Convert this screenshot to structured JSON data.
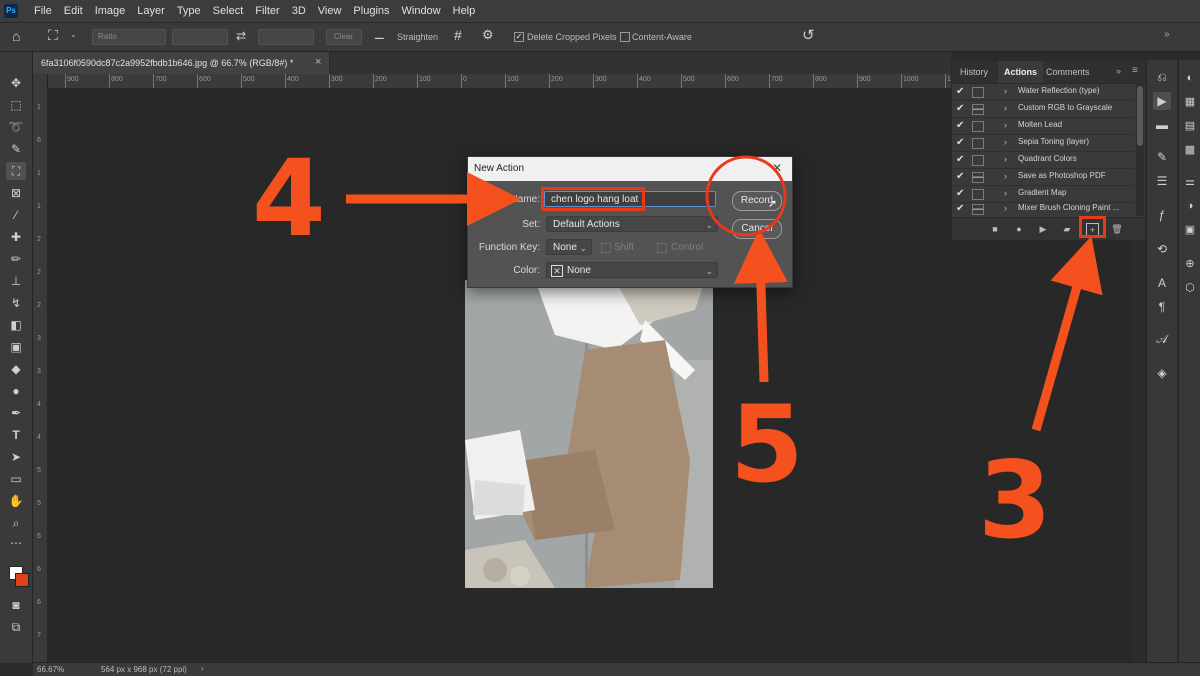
{
  "app": {
    "logo": "Ps"
  },
  "menu": [
    "File",
    "Edit",
    "Image",
    "Layer",
    "Type",
    "Select",
    "Filter",
    "3D",
    "View",
    "Plugins",
    "Window",
    "Help"
  ],
  "options_bar": {
    "ratio_label": "Ratio",
    "clear_label": "Clear",
    "straighten_label": "Straighten",
    "delete_cropped_label": "Delete Cropped Pixels",
    "delete_cropped_checked": true,
    "content_aware_label": "Content-Aware",
    "content_aware_checked": false
  },
  "document": {
    "tab_title": "6fa3106f0590dc87c2a9952fbdb1b646.jpg @ 66.7% (RGB/8#) *",
    "close_symbol": "×"
  },
  "ruler": {
    "h_ticks": [
      "900",
      "800",
      "700",
      "600",
      "500",
      "400",
      "300",
      "200",
      "100",
      "0",
      "100",
      "200",
      "300",
      "400",
      "500",
      "600",
      "700",
      "800",
      "900",
      "1000",
      "1100",
      "1200",
      "1300",
      "1400"
    ],
    "v_ticks": [
      "1",
      "6",
      "1",
      "1",
      "2",
      "2",
      "2",
      "3",
      "3",
      "4",
      "4",
      "5",
      "5",
      "6",
      "6",
      "6",
      "7"
    ]
  },
  "dialog": {
    "title": "New Action",
    "name_label": "Name:",
    "name_value": "chen logo hang loat",
    "set_label": "Set:",
    "set_value": "Default Actions",
    "function_key_label": "Function Key:",
    "function_key_value": "None",
    "shift_label": "Shift",
    "control_label": "Control",
    "color_label": "Color:",
    "color_value": "None",
    "record_label": "Record",
    "cancel_label": "Cancel"
  },
  "panel": {
    "tabs": [
      "History",
      "Actions",
      "Comments"
    ],
    "active_tab": "Actions",
    "actions": [
      {
        "label": "Water Reflection (type)",
        "dialog_box": false
      },
      {
        "label": "Custom RGB to Grayscale",
        "dialog_box": true
      },
      {
        "label": "Molten Lead",
        "dialog_box": false
      },
      {
        "label": "Sepia Toning (layer)",
        "dialog_box": false
      },
      {
        "label": "Quadrant Colors",
        "dialog_box": false
      },
      {
        "label": "Save as Photoshop PDF",
        "dialog_box": true
      },
      {
        "label": "Gradient Map",
        "dialog_box": false
      },
      {
        "label": "Mixer Brush Cloning Paint ...",
        "dialog_box": true
      }
    ]
  },
  "status_bar": {
    "zoom": "66.67%",
    "doc_info": "564 px x 968 px (72 ppi)"
  },
  "annotations": {
    "step_4": "4",
    "step_5": "5",
    "step_3": "3",
    "color": "#f4511e"
  }
}
